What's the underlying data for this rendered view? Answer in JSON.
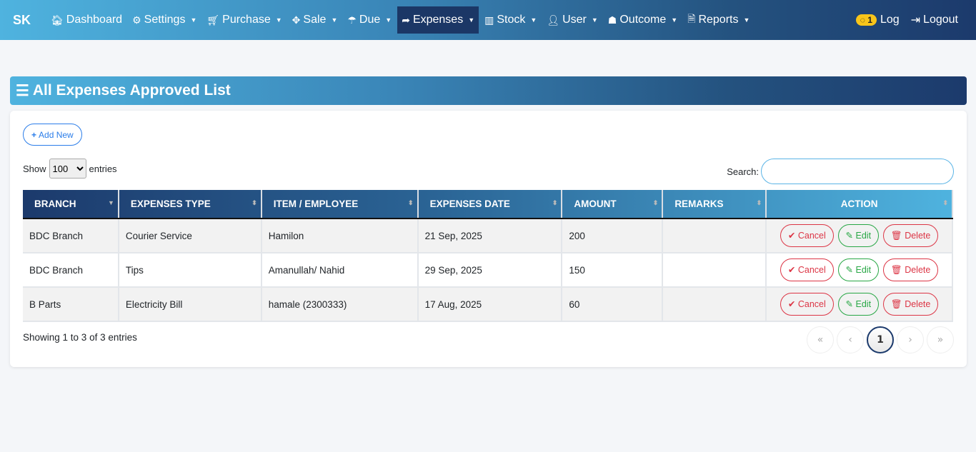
{
  "nav": {
    "brand": "SK",
    "items": [
      {
        "label": "Dashboard",
        "icon": "home-icon",
        "glyph": "🏠︎",
        "caret": false
      },
      {
        "label": "Settings",
        "icon": "cogs-icon",
        "glyph": "⚙",
        "caret": true
      },
      {
        "label": "Purchase",
        "icon": "cart-icon",
        "glyph": "🛒︎",
        "caret": true
      },
      {
        "label": "Sale",
        "icon": "arrows-icon",
        "glyph": "✥",
        "caret": true
      },
      {
        "label": "Due",
        "icon": "umbrella-icon",
        "glyph": "☂",
        "caret": true
      },
      {
        "label": "Expenses",
        "icon": "share-icon",
        "glyph": "➦",
        "caret": true,
        "active": true
      },
      {
        "label": "Stock",
        "icon": "bar-chart-icon",
        "glyph": "▥",
        "caret": true
      },
      {
        "label": "User",
        "icon": "user-icon",
        "glyph": "👤︎",
        "caret": true
      },
      {
        "label": "Outcome",
        "icon": "user-secret-icon",
        "glyph": "☗",
        "caret": true
      },
      {
        "label": "Reports",
        "icon": "file-pdf-icon",
        "glyph": "🗎",
        "caret": true
      }
    ],
    "badge": "1",
    "log": "Log",
    "logout": "Logout"
  },
  "page": {
    "title": "All Expenses Approved List",
    "add_new": "Add New",
    "show": "Show",
    "entries_value": "100",
    "entries": "entries",
    "search_label": "Search:",
    "search_value": "",
    "info": "Showing 1 to 3 of 3 entries",
    "current_page": "1"
  },
  "table": {
    "headers": [
      "BRANCH",
      "EXPENSES TYPE",
      "ITEM / EMPLOYEE",
      "EXPENSES DATE",
      "AMOUNT",
      "REMARKS",
      "ACTION"
    ],
    "rows": [
      [
        "BDC Branch",
        "Courier Service",
        "Hamilon",
        "21 Sep, 2025",
        "200",
        ""
      ],
      [
        "BDC Branch",
        "Tips",
        "Amanullah/ Nahid",
        "29 Sep, 2025",
        "150",
        ""
      ],
      [
        "B Parts",
        "Electricity Bill",
        "hamale (2300333)",
        "17 Aug, 2025",
        "60",
        ""
      ]
    ],
    "actions": {
      "cancel": "Cancel",
      "edit": "Edit",
      "delete": "Delete"
    }
  },
  "colors": {
    "accent": "#1c3a6c",
    "danger": "#dc3545",
    "success": "#28a745",
    "primary": "#2b7de9"
  }
}
